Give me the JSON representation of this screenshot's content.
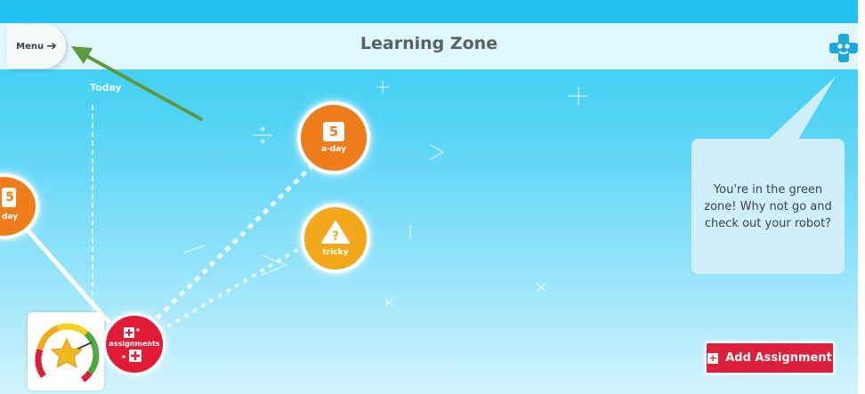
{
  "header": {
    "title": "Learning Zone",
    "menu_label": "Menu",
    "menu_icon": "arrow-right-icon",
    "logo_icon": "robot-logo-icon"
  },
  "timeline": {
    "today_label": "Today"
  },
  "nodes": [
    {
      "number": "5",
      "label": "a-day",
      "color": "#f07d1c",
      "icon": "calendar-icon"
    },
    {
      "symbol": "?",
      "label": "tricky",
      "color": "#f3a81b",
      "icon": "warning-triangle-icon"
    },
    {
      "number": "5",
      "label": "day",
      "color": "#f07d1c",
      "icon": "calendar-icon"
    },
    {
      "label": "assignments",
      "color": "#e31b36",
      "icon": "plus-icon"
    }
  ],
  "assistant": {
    "message": "You're in the green zone! Why not go and check out your robot?"
  },
  "actions": {
    "add_assignment_label": "Add Assignment",
    "add_icon": "plus-box-icon"
  },
  "gauge": {
    "icon": "star-icon",
    "zone": "green"
  },
  "colors": {
    "accent_red": "#dc1f3a",
    "orange": "#f07d1c",
    "yellow": "#f3a81b",
    "sky": "#2fcdf3",
    "annotation_arrow": "#5d9a3a"
  }
}
